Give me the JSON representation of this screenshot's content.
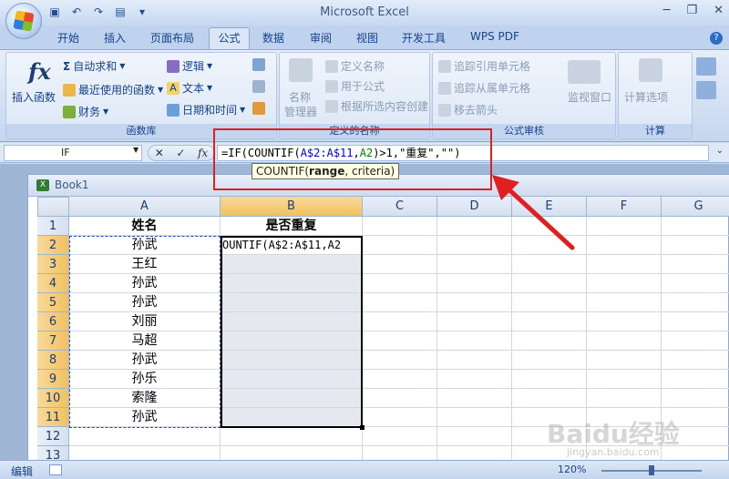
{
  "app": {
    "title": "Microsoft Excel"
  },
  "tabs": [
    "开始",
    "插入",
    "页面布局",
    "公式",
    "数据",
    "审阅",
    "视图",
    "开发工具",
    "WPS PDF"
  ],
  "active_tab": "公式",
  "ribbon": {
    "function_library": {
      "caption": "函数库",
      "insert_function": "插入函数",
      "autosum": "自动求和",
      "recent": "最近使用的函数",
      "financial": "财务",
      "logical": "逻辑",
      "text": "文本",
      "datetime": "日期和时间"
    },
    "defined_names": {
      "caption": "定义的名称",
      "name_manager_1": "名称",
      "name_manager_2": "管理器",
      "define_name": "定义名称",
      "use_in_formula": "用于公式",
      "create_from_selection": "根据所选内容创建"
    },
    "formula_auditing": {
      "caption": "公式审核",
      "trace_precedents": "追踪引用单元格",
      "trace_dependents": "追踪从属单元格",
      "remove_arrows": "移去箭头",
      "watch_window": "监视窗口"
    },
    "calculation": {
      "caption": "计算",
      "options": "计算选项"
    }
  },
  "formula_bar": {
    "name_box": "IF",
    "formula_prefix": "=IF(COUNTIF(",
    "ref1": "A$2:A$11",
    "sep": ",",
    "ref2": "A2",
    "formula_suffix": ")>1,\"重复\",\"\")",
    "tooltip": "COUNTIF(range, criteria)",
    "tooltip_func": "COUNTIF(",
    "tooltip_bold": "range",
    "tooltip_rest": ", criteria)"
  },
  "workbook": {
    "title": "Book1"
  },
  "sheet": {
    "columns": [
      "A",
      "B",
      "C",
      "D",
      "E",
      "F",
      "G"
    ],
    "rows": [
      "1",
      "2",
      "3",
      "4",
      "5",
      "6",
      "7",
      "8",
      "9",
      "10",
      "11",
      "12",
      "13"
    ],
    "header_a": "姓名",
    "header_b": "是否重复",
    "names": [
      "孙武",
      "王红",
      "孙武",
      "孙武",
      "刘丽",
      "马超",
      "孙武",
      "孙乐",
      "索隆",
      "孙武"
    ],
    "b2_text": "OUNTIF(A$2:A$11,A2"
  },
  "status": {
    "mode": "编辑",
    "zoom": "120%"
  },
  "watermark": "Baidu经验",
  "watermark_sub": "jingyan.baidu.com",
  "colors": {
    "highlight": "#e02020",
    "ref1": "#0000e0",
    "ref2": "#008000"
  }
}
